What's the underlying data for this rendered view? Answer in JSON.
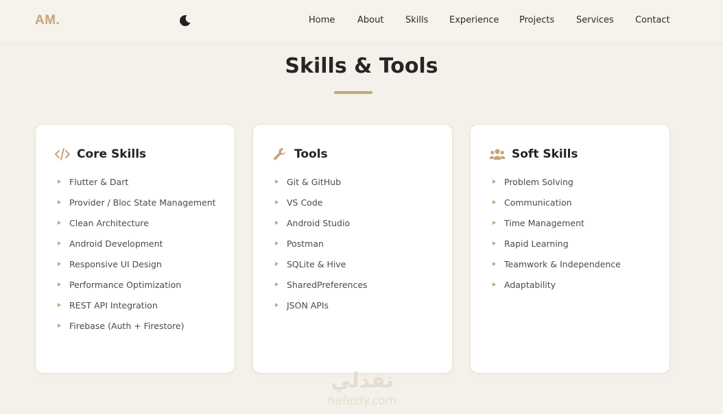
{
  "header": {
    "logo": "AM.",
    "theme_toggle_icon": "moon-icon",
    "nav": [
      "Home",
      "About",
      "Skills",
      "Experience",
      "Projects",
      "Services",
      "Contact"
    ]
  },
  "section": {
    "title": "Skills & Tools"
  },
  "cards": [
    {
      "icon": "code-icon",
      "title": "Core Skills",
      "items": [
        "Flutter & Dart",
        "Provider / Bloc State Management",
        "Clean Architecture",
        "Android Development",
        "Responsive UI Design",
        "Performance Optimization",
        "REST API Integration",
        "Firebase (Auth + Firestore)"
      ]
    },
    {
      "icon": "wrench-icon",
      "title": "Tools",
      "items": [
        "Git & GitHub",
        "VS Code",
        "Android Studio",
        "Postman",
        "SQLite & Hive",
        "SharedPreferences",
        "JSON APIs"
      ]
    },
    {
      "icon": "users-icon",
      "title": "Soft Skills",
      "items": [
        "Problem Solving",
        "Communication",
        "Time Management",
        "Rapid Learning",
        "Teamwork & Independence",
        "Adaptability"
      ]
    }
  ],
  "watermark": {
    "arabic": "نفذلي",
    "latin": "nafezly.com"
  },
  "colors": {
    "accent": "#c4a574",
    "background": "#f4f1ea",
    "card": "#ffffff",
    "text": "#2a2a2a"
  }
}
